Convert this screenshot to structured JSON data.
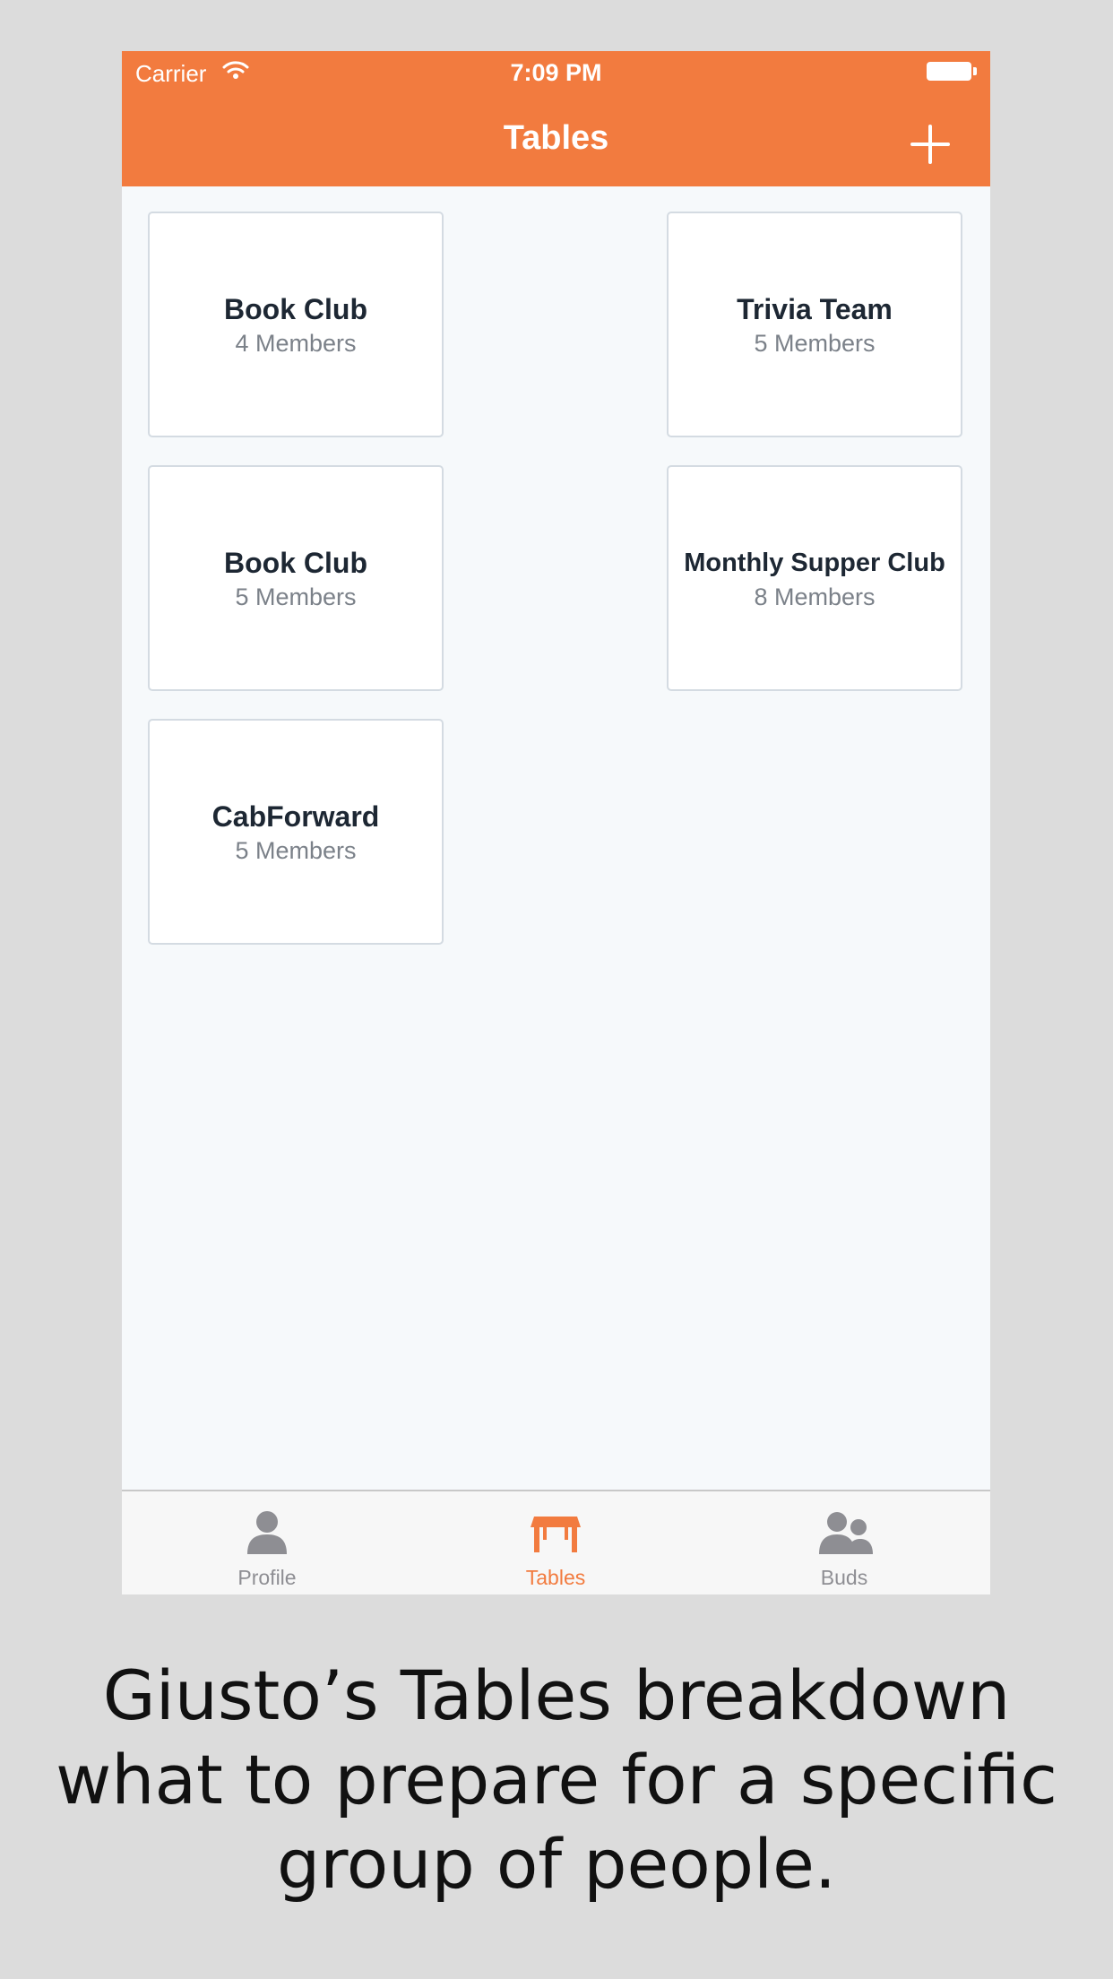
{
  "status_bar": {
    "carrier": "Carrier",
    "time": "7:09 PM"
  },
  "nav": {
    "title": "Tables",
    "add_icon": "plus-icon"
  },
  "tables": [
    {
      "name": "Book Club",
      "members": "4 Members"
    },
    {
      "name": "Trivia Team",
      "members": "5 Members"
    },
    {
      "name": "Book Club",
      "members": "5 Members"
    },
    {
      "name": "Monthly Supper Club",
      "members": "8 Members"
    },
    {
      "name": "CabForward",
      "members": "5 Members"
    }
  ],
  "tab_bar": {
    "items": [
      {
        "label": "Profile",
        "icon": "person-icon",
        "active": false
      },
      {
        "label": "Tables",
        "icon": "table-icon",
        "active": true
      },
      {
        "label": "Buds",
        "icon": "people-icon",
        "active": false
      }
    ]
  },
  "caption": {
    "lines": [
      "Giusto’s Tables breakdown",
      "what to prepare for a specific",
      "group of people."
    ]
  },
  "colors": {
    "accent": "#f27b3f",
    "background": "#dcdcdc",
    "content_background": "#f6f9fb"
  }
}
